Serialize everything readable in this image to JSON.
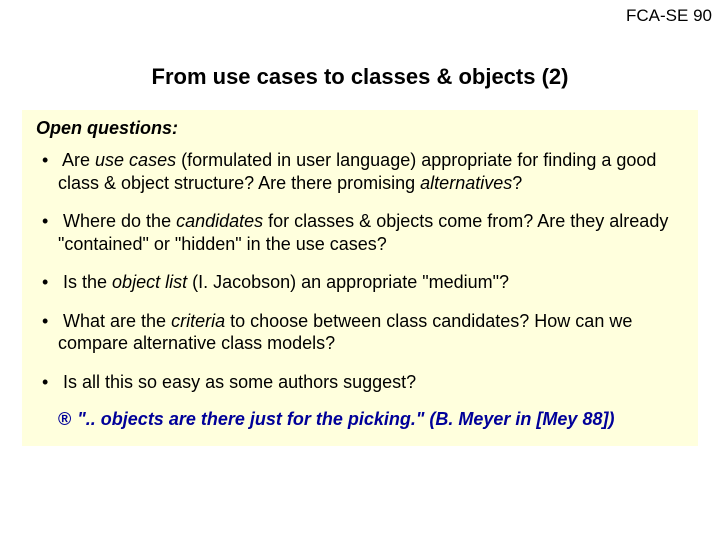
{
  "header": {
    "label": "FCA-SE 90"
  },
  "title": "From use cases to classes & objects (2)",
  "box": {
    "heading": "Open questions:",
    "bullets": {
      "b1": {
        "pre": "Are ",
        "em1": "use cases",
        "mid": " (formulated in user language) appropriate for finding a good class & object structure? Are there promising ",
        "em2": "alternatives",
        "post": "?"
      },
      "b2": {
        "pre": "Where do the ",
        "em1": "candidates",
        "post": " for classes & objects come from? Are they already \"contained\" or \"hidden\" in the use cases?"
      },
      "b3": {
        "pre": "Is the ",
        "em1": "object list",
        "post": " (I. Jacobson) an appropriate \"medium\"?"
      },
      "b4": {
        "pre": "What are the ",
        "em1": "criteria",
        "post": " to choose between class candidates? How can we compare alternative class models?"
      },
      "b5": {
        "text": "Is all this so easy as some authors suggest?"
      }
    },
    "quote": {
      "arrow": "®",
      "text": "\".. objects are there just for the picking.\" (B. Meyer in [Mey 88])"
    }
  }
}
